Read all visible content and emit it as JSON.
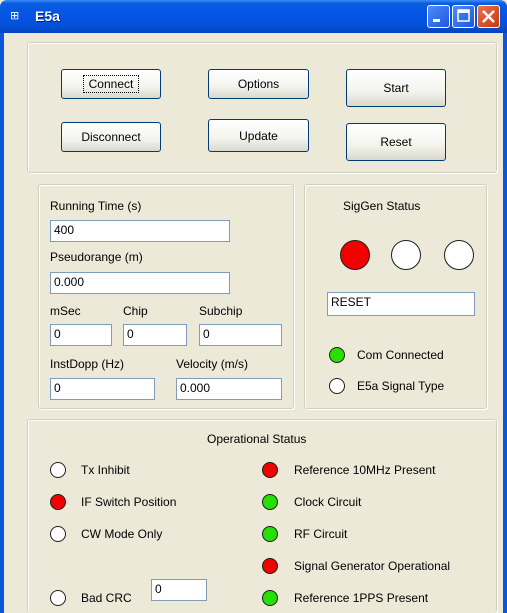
{
  "window": {
    "title": "E5a",
    "icon": "app-icon"
  },
  "buttons": {
    "connect": "Connect",
    "options": "Options",
    "start": "Start",
    "disconnect": "Disconnect",
    "update": "Update",
    "reset": "Reset"
  },
  "params": {
    "running_time_label": "Running Time (s)",
    "running_time_value": "400",
    "pseudorange_label": "Pseudorange (m)",
    "pseudorange_value": "0.000",
    "msec_label": "mSec",
    "msec_value": "0",
    "chip_label": "Chip",
    "chip_value": "0",
    "subchip_label": "Subchip",
    "subchip_value": "0",
    "instdopp_label": "InstDopp (Hz)",
    "instdopp_value": "0",
    "velocity_label": "Velocity (m/s)",
    "velocity_value": "0.000"
  },
  "siggen": {
    "title": "SigGen Status",
    "leds": [
      "red",
      "off",
      "off"
    ],
    "status_text": "RESET",
    "com_label": "Com Connected",
    "com_color": "green",
    "signal_type_label": "E5a Signal Type",
    "signal_type_color": "off"
  },
  "operational": {
    "title": "Operational Status",
    "left": [
      {
        "label": "Tx Inhibit",
        "color": "off"
      },
      {
        "label": "IF Switch Position",
        "color": "red"
      },
      {
        "label": "CW Mode Only",
        "color": "off"
      }
    ],
    "right": [
      {
        "label": "Reference 10MHz Present",
        "color": "red"
      },
      {
        "label": "Clock Circuit",
        "color": "green"
      },
      {
        "label": "RF Circuit",
        "color": "green"
      },
      {
        "label": "Signal Generator Operational",
        "color": "red"
      },
      {
        "label": "Reference 1PPS Present",
        "color": "green"
      }
    ],
    "bad_crc_label": "Bad CRC",
    "bad_crc_color": "off",
    "bad_crc_value": "0"
  },
  "colors": {
    "red": "#F20000",
    "green": "#28E000",
    "off": "#FFFFFF",
    "titlebar": "#0454E6"
  }
}
